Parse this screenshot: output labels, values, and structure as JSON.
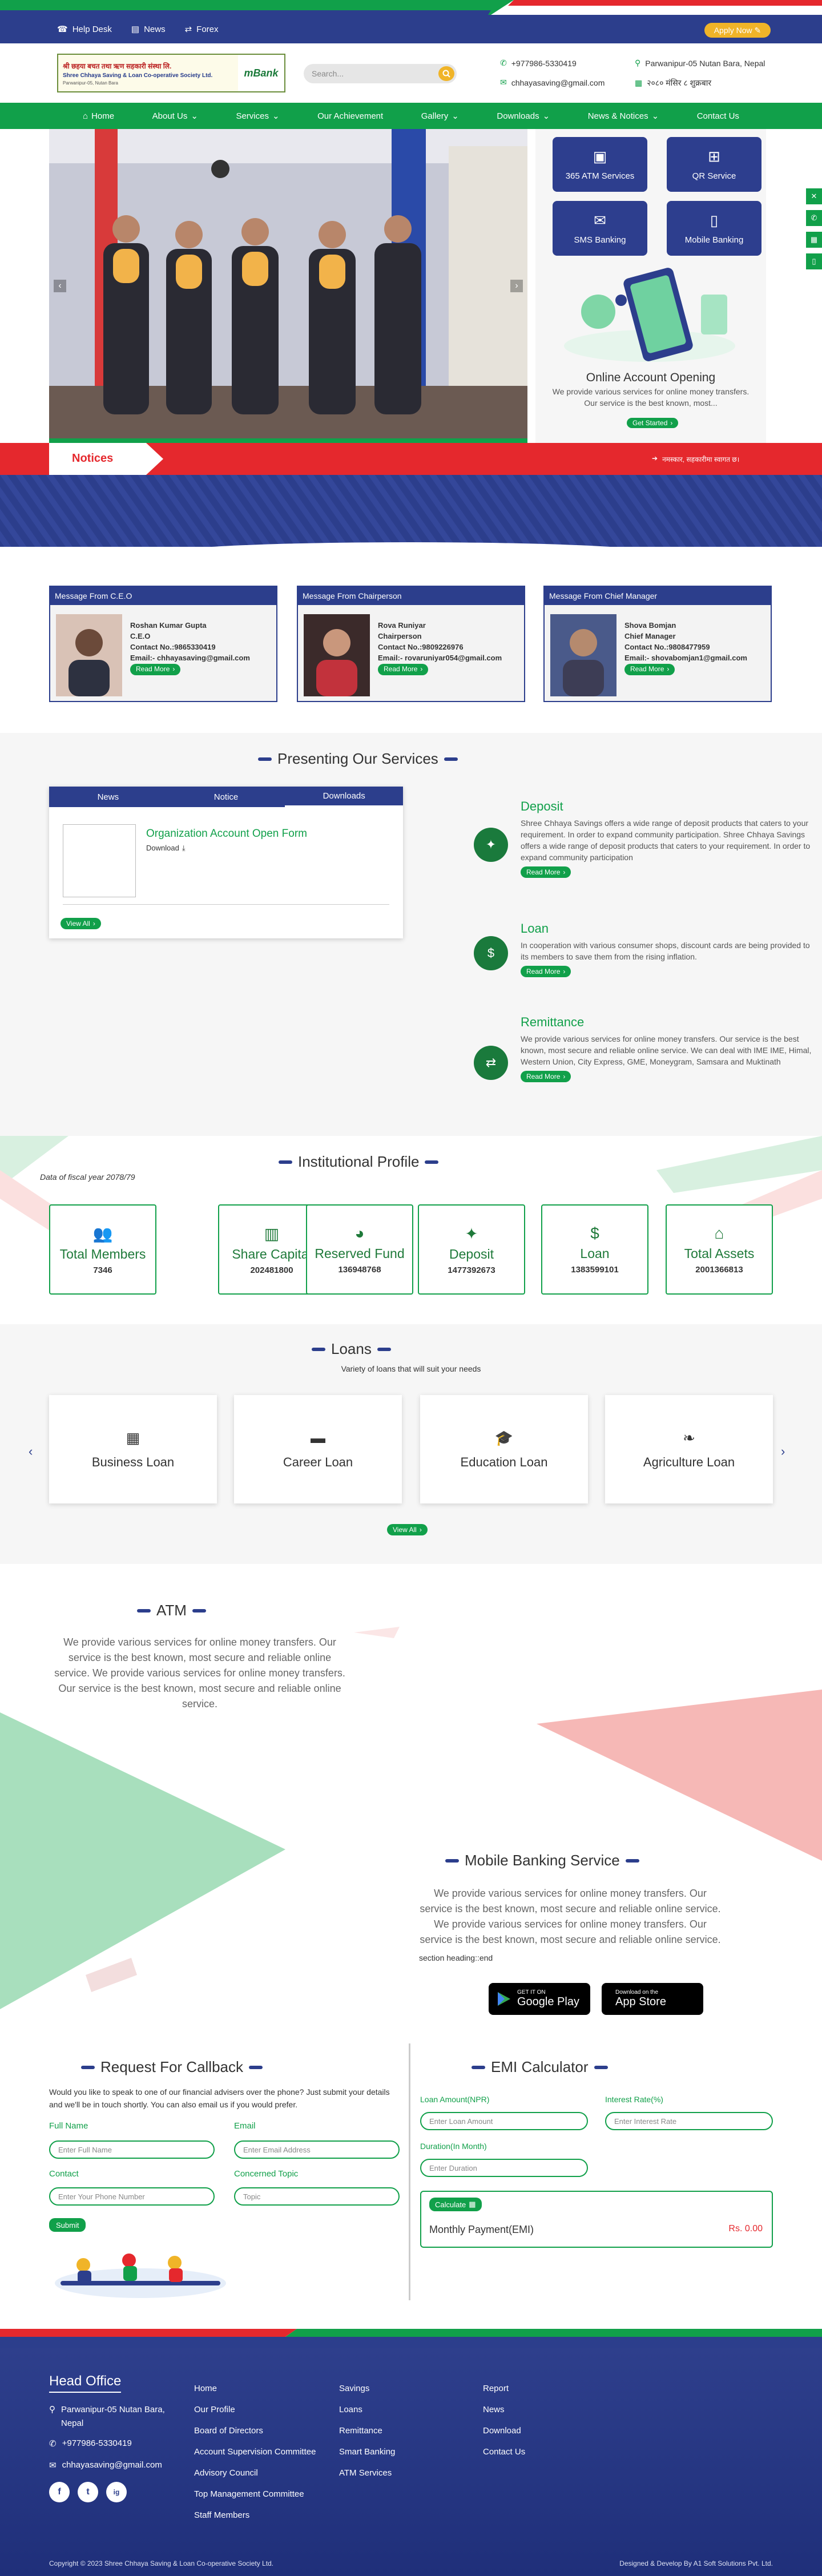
{
  "topbar": {
    "help_desk": "Help Desk",
    "news": "News",
    "forex": "Forex",
    "apply_now": "Apply Now"
  },
  "header": {
    "logo_line1": "श्री छहया बचत तथा ऋण सहकारी संस्था लि.",
    "logo_line2": "Shree Chhaya Saving & Loan Co-operative Society Ltd.",
    "logo_line3": "Parwanipur-05, Nutan Bara",
    "logo_brand": "mBank",
    "search_placeholder": "Search...",
    "phone": "+977986-5330419",
    "email": "chhayasaving@gmail.com",
    "address": "Parwanipur-05 Nutan Bara, Nepal",
    "date": "२०८० मंसिर ८ शुक्रबार"
  },
  "nav": {
    "items": [
      "Home",
      "About Us",
      "Services",
      "Our Achievement",
      "Gallery",
      "Downloads",
      "News & Notices",
      "Contact Us"
    ]
  },
  "hero_side": {
    "buttons": [
      "365 ATM Services",
      "QR Service",
      "SMS Banking",
      "Mobile Banking"
    ],
    "title": "Online Account Opening",
    "text": "We provide various services for online money transfers. Our service is the best known, most...",
    "cta": "Get Started"
  },
  "notices": {
    "label": "Notices",
    "ticker": "नमस्कार, सहकारीमा स्वागत छ।"
  },
  "messages": [
    {
      "header": "Message From C.E.O",
      "name": "Roshan Kumar Gupta",
      "role": "C.E.O",
      "contact": "Contact No.:9865330419",
      "email": "Email:- chhayasaving@gmail.com",
      "btn": "Read More"
    },
    {
      "header": "Message From Chairperson",
      "name": "Rova Runiyar",
      "role": "Chairperson",
      "contact": "Contact No.:9809226976",
      "email": "Email:- rovaruniyar054@gmail.com",
      "btn": "Read More"
    },
    {
      "header": "Message From Chief Manager",
      "name": "Shova Bomjan",
      "role": "Chief Manager",
      "contact": "Contact No.:9808477959",
      "email": "Email:- shovabomjan1@gmail.com",
      "btn": "Read More"
    }
  ],
  "services": {
    "title": "Presenting Our Services",
    "tabs": [
      "News",
      "Notice",
      "Downloads"
    ],
    "download_title": "Organization Account Open Form",
    "download_label": "Download",
    "view_all": "View All",
    "items": [
      {
        "title": "Deposit",
        "text": "Shree Chhaya Savings offers a wide range of deposit products that caters to your requirement. In order to expand community participation. Shree Chhaya Savings offers a wide range of deposit products that caters to your requirement. In order to expand community participation",
        "btn": "Read More"
      },
      {
        "title": "Loan",
        "text": "In cooperation with various consumer shops, discount cards are being provided to its members to save them from the rising inflation.",
        "btn": "Read More"
      },
      {
        "title": "Remittance",
        "text": "We provide various services for online money transfers. Our service is the best known, most secure and reliable online service. We can deal with IME IME, Himal, Western Union, City Express, GME, Moneygram, Samsara and Muktinath",
        "btn": "Read More"
      }
    ]
  },
  "profile": {
    "title": "Institutional Profile",
    "note": "Data of fiscal year 2078/79",
    "items": [
      {
        "label": "Total Members",
        "value": "7346"
      },
      {
        "label": "Share Capital",
        "value": "202481800"
      },
      {
        "label": "Reserved Fund",
        "value": "136948768"
      },
      {
        "label": "Deposit",
        "value": "1477392673"
      },
      {
        "label": "Loan",
        "value": "1383599101"
      },
      {
        "label": "Total Assets",
        "value": "2001366813"
      }
    ]
  },
  "loans": {
    "title": "Loans",
    "subtitle": "Variety of loans that will suit your needs",
    "items": [
      "Business Loan",
      "Career Loan",
      "Education Loan",
      "Agriculture Loan"
    ],
    "view_all": "View All"
  },
  "atm": {
    "title": "ATM",
    "text": "We provide various services for online money transfers. Our service is the best known, most secure and reliable online service. We provide various services for online money transfers. Our service is the best known, most secure and reliable online service."
  },
  "mobile": {
    "title": "Mobile Banking Service",
    "text": "We provide various services for online money transfers. Our service is the best known, most secure and reliable online service. We provide various services for online money transfers. Our service is the best known, most secure and reliable online service.",
    "end_note": "section heading::end",
    "gp_small": "GET IT ON",
    "gp_big": "Google Play",
    "as_small": "Download on the",
    "as_big": "App Store"
  },
  "callback": {
    "title": "Request For Callback",
    "text": "Would you like to speak to one of our financial advisers over the phone? Just submit your details and we'll be in touch shortly. You can also email us if you would prefer.",
    "labels": [
      "Full Name",
      "Email",
      "Contact",
      "Concerned Topic"
    ],
    "placeholders": [
      "Enter Full Name",
      "Enter Email Address",
      "Enter Your Phone Number",
      "Topic"
    ],
    "submit": "Submit"
  },
  "emi": {
    "title": "EMI Calculator",
    "labels": [
      "Loan Amount(NPR)",
      "Interest Rate(%)",
      "Duration(In Month)"
    ],
    "placeholders": [
      "Enter Loan Amount",
      "Enter Interest Rate",
      "Enter Duration"
    ],
    "calc": "Calculate",
    "result_label": "Monthly Payment(EMI)",
    "result_value": "Rs. 0.00"
  },
  "footer": {
    "head": "Head Office",
    "address": "Parwanipur-05 Nutan Bara, Nepal",
    "phone": "+977986-5330419",
    "email": "chhayasaving@gmail.com",
    "social": [
      "f",
      "t",
      "ig"
    ],
    "col1": [
      "Home",
      "Our Profile",
      "Board of Directors",
      "Account Supervision Committee",
      "Advisory Council",
      "Top Management Committee",
      "Staff Members"
    ],
    "col2": [
      "Savings",
      "Loans",
      "Remittance",
      "Smart Banking",
      "ATM Services"
    ],
    "col3": [
      "Report",
      "News",
      "Download",
      "Contact Us"
    ],
    "copyright": "Copyright © 2023 Shree Chhaya Saving & Loan Co-operative Society Ltd.",
    "credit": "Designed & Develop By A1 Soft Solutions Pvt. Ltd."
  },
  "colors": {
    "blue": "#2c3e8c",
    "green": "#11a04a",
    "red": "#e5282d",
    "gold": "#f0b428"
  }
}
